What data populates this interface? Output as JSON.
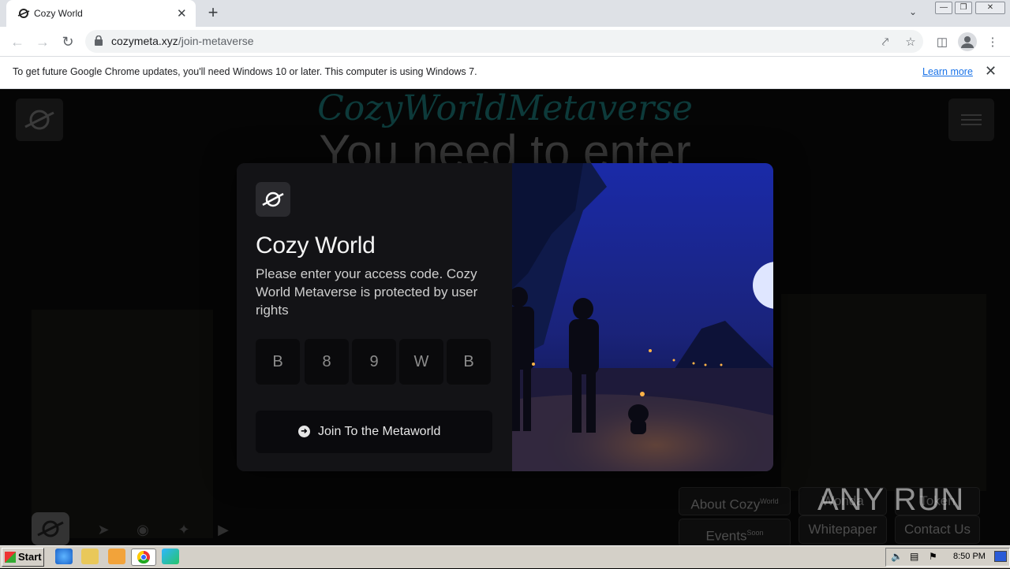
{
  "browser": {
    "tab_title": "Cozy World",
    "url_host": "cozymeta.xyz",
    "url_path": "/join-metaverse"
  },
  "infobar": {
    "message": "To get future Google Chrome updates, you'll need Windows 10 or later. This computer is using Windows 7.",
    "link": "Learn more"
  },
  "background_page": {
    "logo_text": "CozyWorldMetaverse",
    "heading": "You need to enter",
    "nav_pills": [
      {
        "label": "About Cozy",
        "sup": "World"
      },
      {
        "label": "Events",
        "sup": "Soon"
      },
      {
        "label": "Wonda"
      },
      {
        "label": "Whitepaper"
      },
      {
        "label": "Token"
      },
      {
        "label": "Contact Us"
      }
    ]
  },
  "modal": {
    "title": "Cozy World",
    "description": "Please enter your access code. Cozy World Metaverse is protected by user rights",
    "code": [
      "B",
      "8",
      "9",
      "W",
      "B"
    ],
    "join_button": "Join To the Metaworld"
  },
  "watermark": "ANY RUN",
  "taskbar": {
    "start": "Start",
    "clock": "8:50 PM"
  }
}
